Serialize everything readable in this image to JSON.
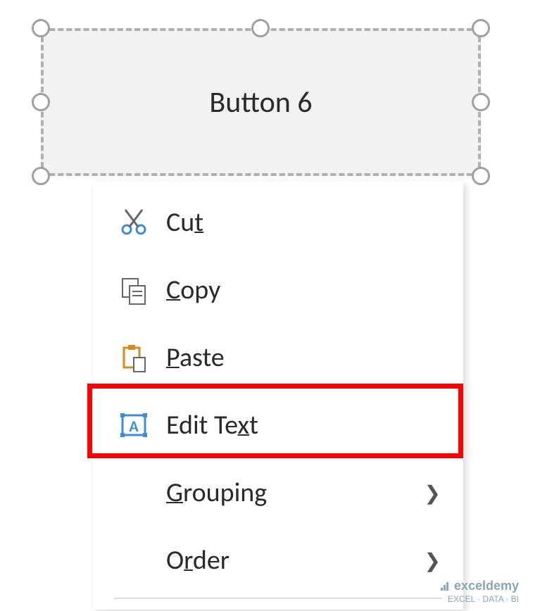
{
  "button": {
    "label": "Button 6"
  },
  "contextMenu": {
    "items": [
      {
        "label": "Cut",
        "underlineChar": "t",
        "hasSubmenu": false
      },
      {
        "label": "Copy",
        "underlineChar": "C",
        "hasSubmenu": false
      },
      {
        "label": "Paste",
        "underlineChar": "P",
        "hasSubmenu": false
      },
      {
        "label": "Edit Text",
        "underlineChar": "x",
        "hasSubmenu": false,
        "highlighted": true
      },
      {
        "label": "Grouping",
        "underlineChar": "G",
        "hasSubmenu": true
      },
      {
        "label": "Order",
        "underlineChar": "r",
        "hasSubmenu": true
      }
    ]
  },
  "watermark": {
    "brand": "exceldemy",
    "tagline": "EXCEL · DATA · BI"
  },
  "colors": {
    "highlight": "#ff0000",
    "buttonBg": "#f2f2f2",
    "handleBorder": "#a0a0a0"
  }
}
